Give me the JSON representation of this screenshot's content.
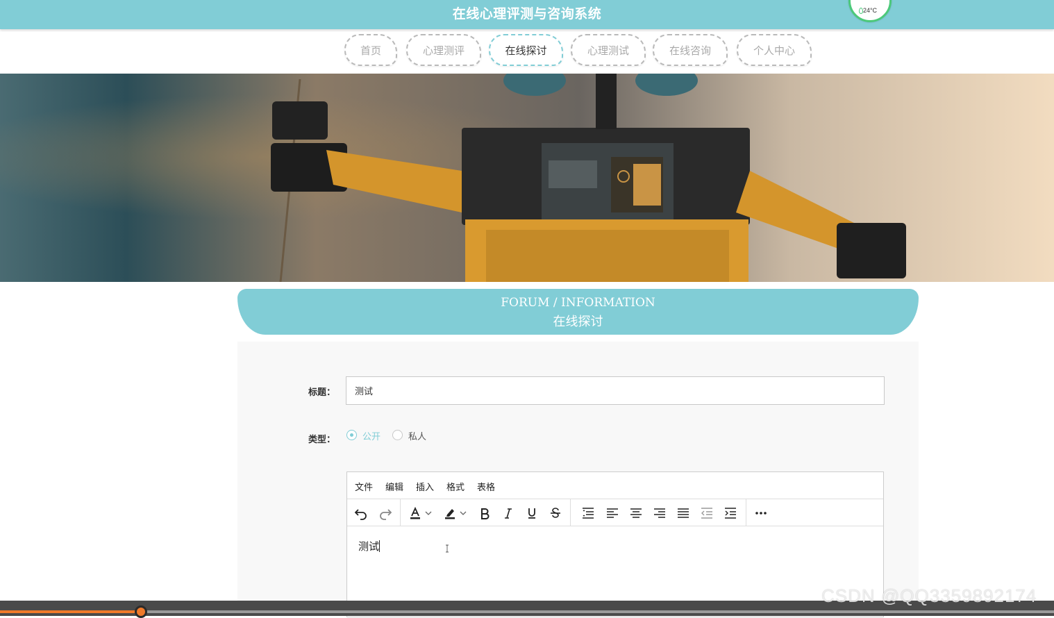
{
  "header": {
    "site_title": "在线心理评测与咨询系统",
    "weather_temp": "24°C"
  },
  "nav": {
    "items": [
      {
        "label": "首页",
        "active": false
      },
      {
        "label": "心理测评",
        "active": false
      },
      {
        "label": "在线探讨",
        "active": true
      },
      {
        "label": "心理测试",
        "active": false
      },
      {
        "label": "在线咨询",
        "active": false
      },
      {
        "label": "个人中心",
        "active": false
      }
    ]
  },
  "section": {
    "title_en": "FORUM / INFORMATION",
    "title_cn": "在线探讨"
  },
  "form": {
    "title_label": "标题：",
    "title_value": "测试",
    "type_label": "类型：",
    "type_options": [
      {
        "label": "公开",
        "checked": true
      },
      {
        "label": "私人",
        "checked": false
      }
    ]
  },
  "editor": {
    "menu": [
      "文件",
      "编辑",
      "插入",
      "格式",
      "表格"
    ],
    "toolbar_icons": [
      "undo-icon",
      "redo-icon",
      "font-color-icon",
      "highlight-icon",
      "bold-icon",
      "italic-icon",
      "underline-icon",
      "strikethrough-icon",
      "line-spacing-icon",
      "align-left-icon",
      "align-center-icon",
      "align-right-icon",
      "justify-icon",
      "outdent-icon",
      "indent-icon",
      "more-icon"
    ],
    "content": "测试"
  },
  "video": {
    "progress": 0.134
  },
  "watermark": "CSDN @QQ3359892174",
  "colors": {
    "accent": "#81cdd6",
    "progress": "#f07a2a"
  }
}
